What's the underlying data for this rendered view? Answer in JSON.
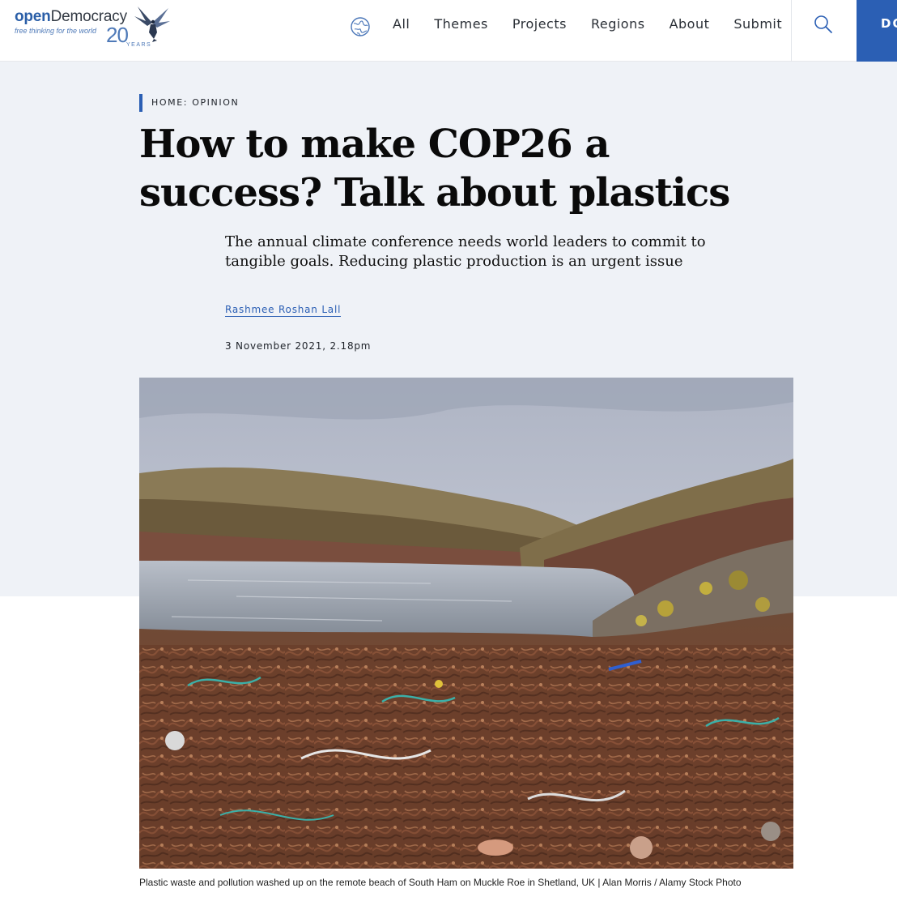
{
  "header": {
    "logo": {
      "word_open": "open",
      "word_democracy": "Democracy",
      "tagline": "free thinking for the world",
      "anniversary_number": "20",
      "anniversary_label": "YEARS"
    },
    "globe_icon": "globe-icon",
    "nav": [
      "All",
      "Themes",
      "Projects",
      "Regions",
      "About",
      "Submit"
    ],
    "search_icon": "search-icon",
    "donate_label": "DONATE"
  },
  "article": {
    "breadcrumb_home": "HOME",
    "breadcrumb_separator": ": ",
    "breadcrumb_section": "OPINION",
    "headline": "How to make COP26 a success? Talk about plastics",
    "standfirst": "The annual climate conference needs world leaders to commit to tangible goals. Reducing plastic production is an urgent issue",
    "author": "Rashmee Roshan Lall",
    "date": "3 November 2021, 2.18pm",
    "image_caption": "Plastic waste and pollution washed up on the remote beach of South Ham on Muckle Roe in Shetland, UK | Alan Morris / Alamy Stock Photo"
  },
  "colors": {
    "accent": "#2b5fb4",
    "hero_background": "#eff2f7",
    "headline": "#0a0a0a"
  }
}
